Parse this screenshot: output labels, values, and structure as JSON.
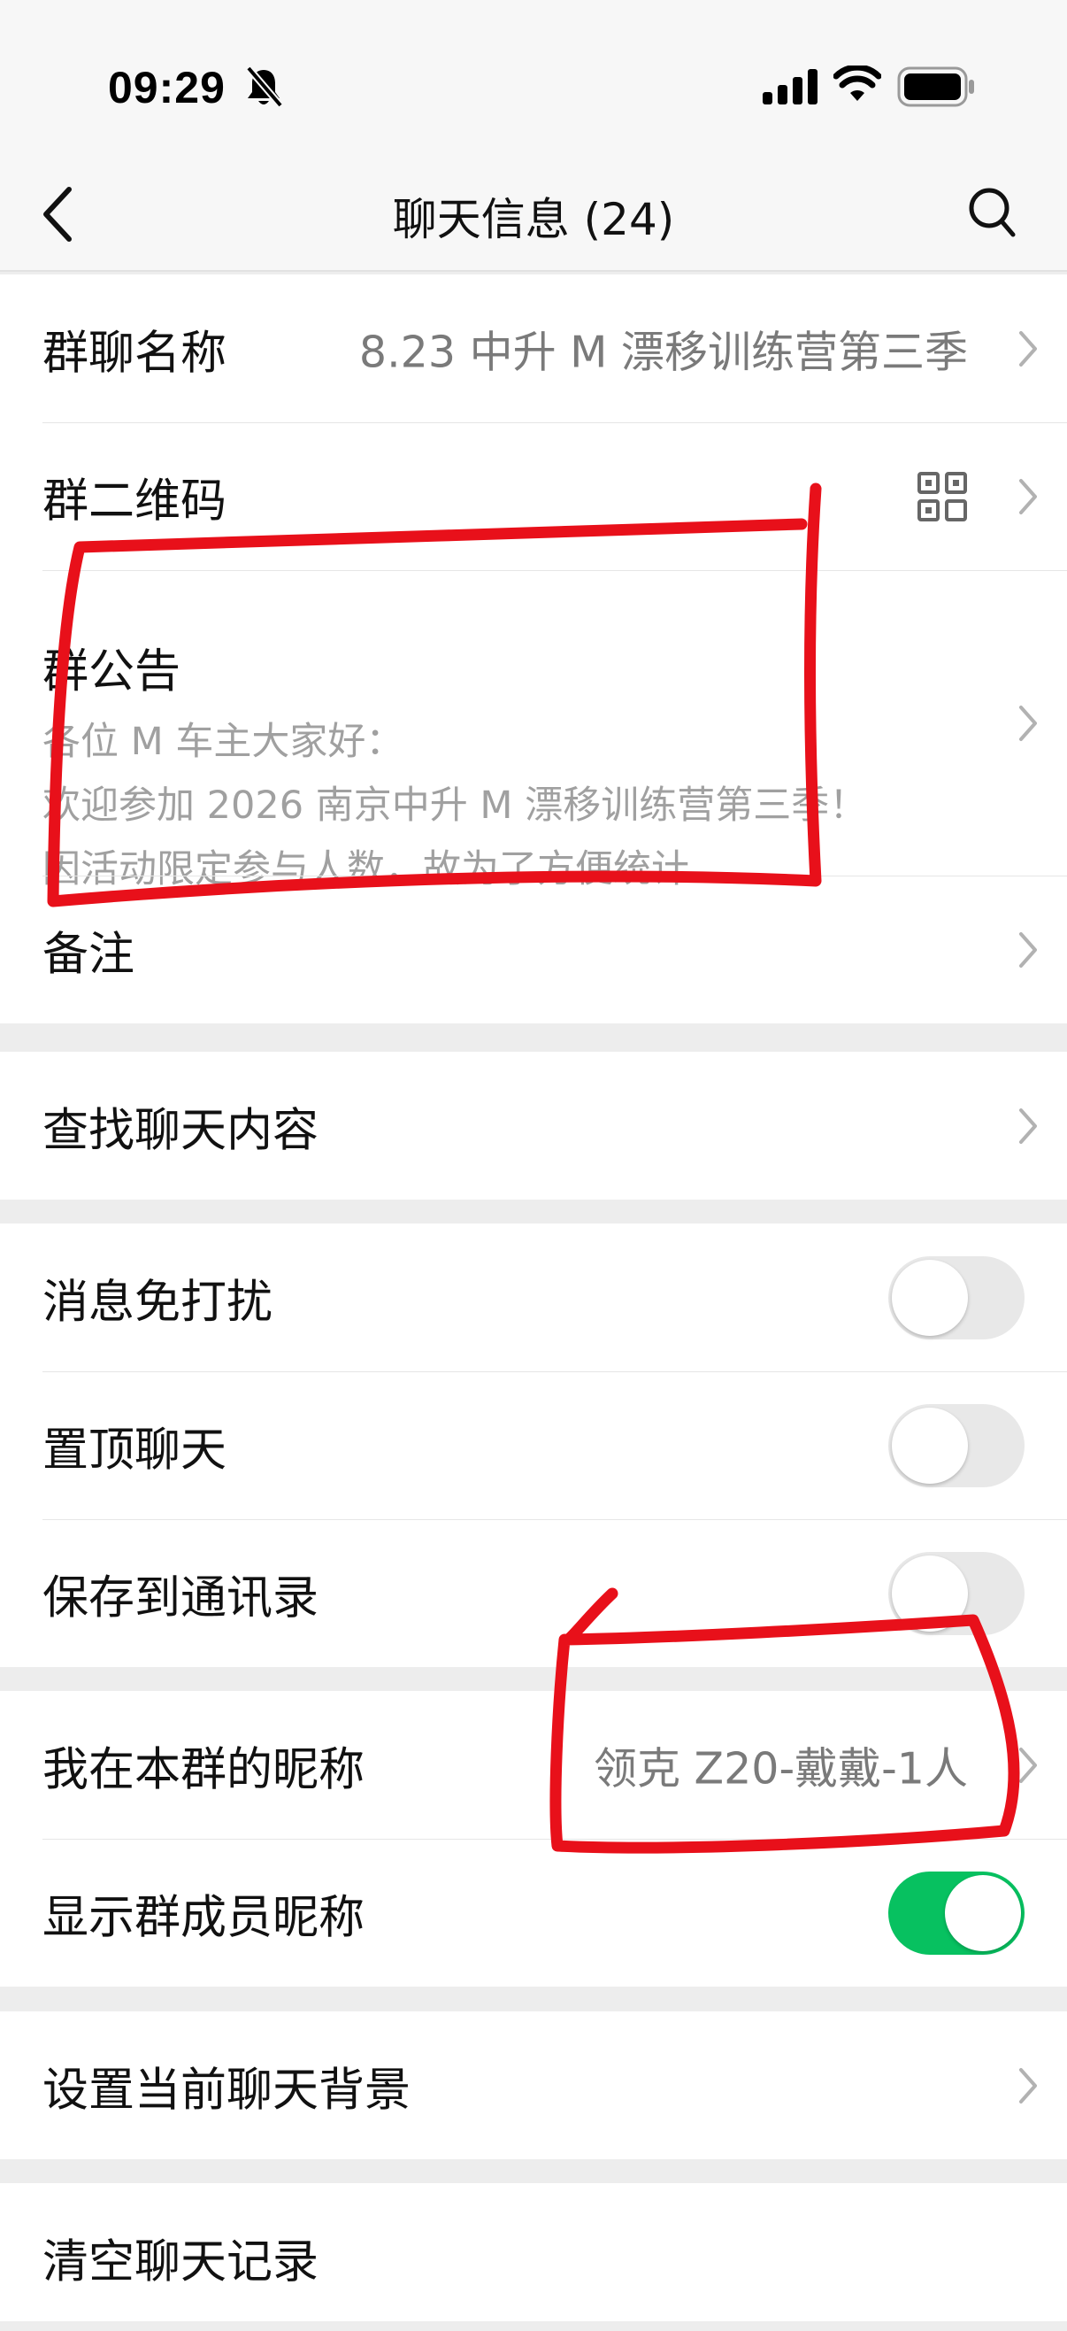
{
  "status_bar": {
    "time": "09:29",
    "icons": [
      "bell-slash-icon",
      "signal-icon",
      "wifi-icon",
      "battery-icon"
    ]
  },
  "nav": {
    "title": "聊天信息 (24)",
    "back_icon": "chevron-left-icon",
    "search_icon": "search-icon"
  },
  "group_info": {
    "name_label": "群聊名称",
    "name_value": "8.23 中升 M 漂移训练营第三季",
    "qr_label": "群二维码",
    "notice_label": "群公告",
    "notice_lines": [
      "各位 M 车主大家好：",
      "欢迎参加 2026 南京中升 M 漂移训练营第三季！",
      "因活动限定参与人数，故为了方便统计…"
    ],
    "remark_label": "备注"
  },
  "search_chat": {
    "label": "查找聊天内容"
  },
  "settings": {
    "mute_label": "消息免打扰",
    "mute_on": false,
    "pin_label": "置顶聊天",
    "pin_on": false,
    "save_contacts_label": "保存到通讯录",
    "save_contacts_on": false
  },
  "nickname": {
    "my_nickname_label": "我在本群的昵称",
    "my_nickname_value": "领克 Z20-戴戴-1人",
    "show_nicknames_label": "显示群成员昵称",
    "show_nicknames_on": true
  },
  "background": {
    "label": "设置当前聊天背景"
  },
  "clear": {
    "label": "清空聊天记录"
  },
  "colors": {
    "toggle_on": "#07c160",
    "toggle_off": "#e8e8e8",
    "annotation": "#e8101a"
  }
}
